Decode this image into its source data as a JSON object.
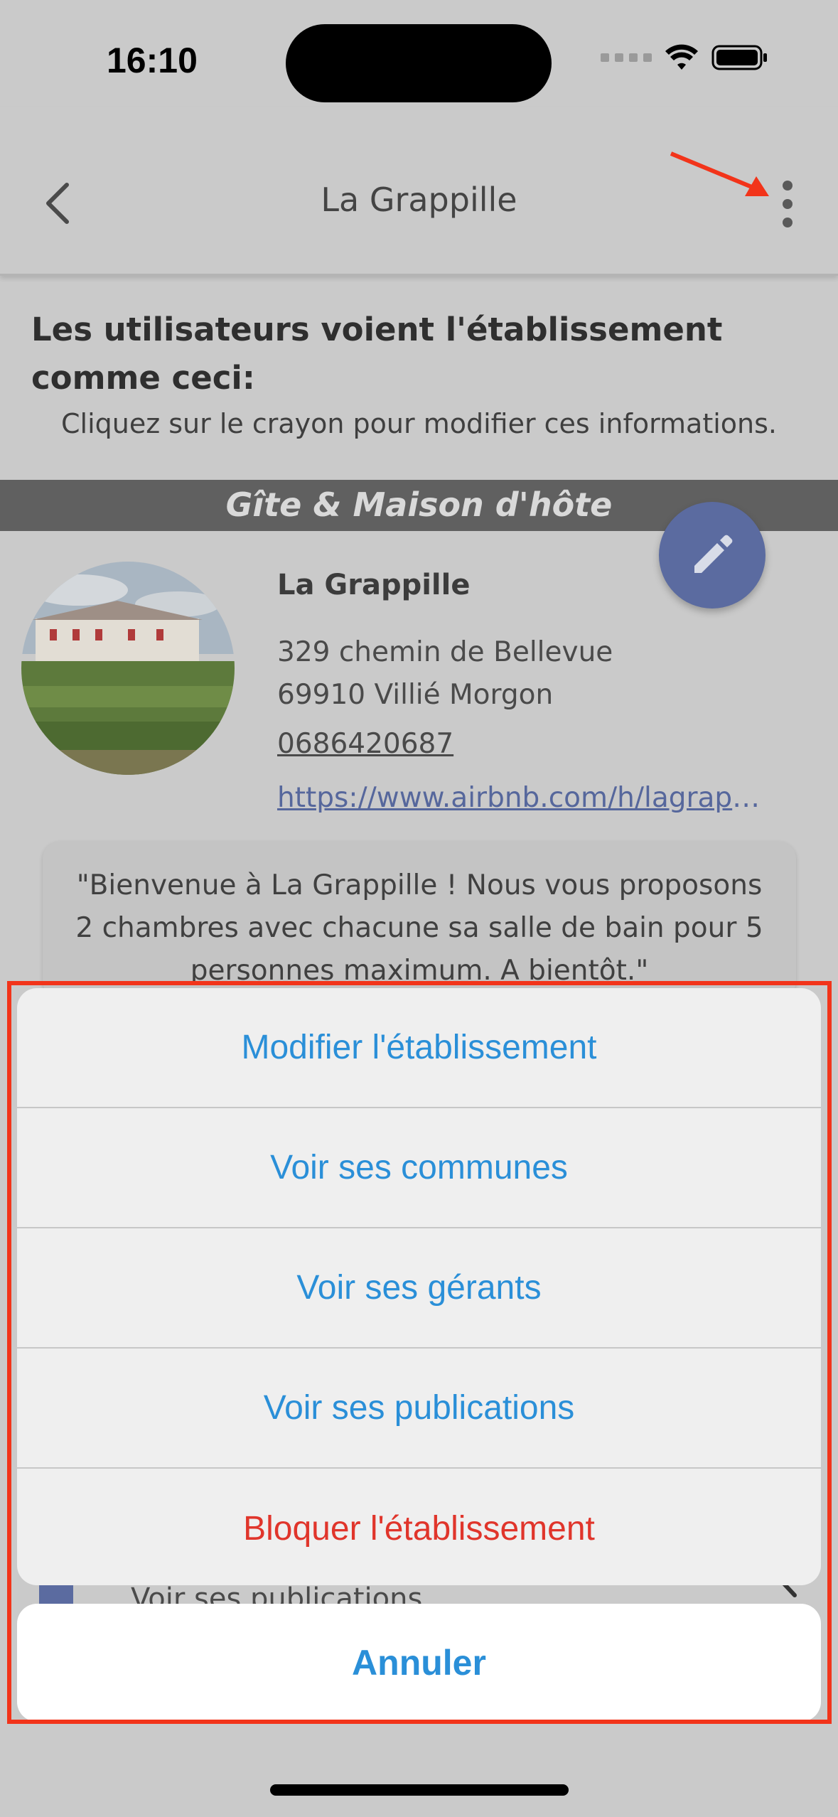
{
  "status_bar": {
    "time": "16:10",
    "icons": [
      "cellular-dots-icon",
      "wifi-icon",
      "battery-icon"
    ]
  },
  "nav": {
    "title": "La Grappille",
    "back_icon": "chevron-left-icon",
    "more_icon": "more-vertical-icon"
  },
  "intro": {
    "heading": "Les utilisateurs voient l'établissement comme ceci:",
    "subheading": "Cliquez sur le crayon pour modifier ces informations."
  },
  "category": "Gîte & Maison d'hôte",
  "establishment": {
    "name": "La Grappille",
    "address_line1": "329 chemin de Bellevue",
    "address_line2": "69910 Villié Morgon",
    "phone": "0686420687",
    "url": "https://www.airbnb.com/h/lagrappille",
    "description": "\"Bienvenue à La Grappille ! Nous vous proposons 2 chambres avec chacune sa salle de bain pour 5 personnes maximum. A bientôt.\""
  },
  "behind_row": {
    "label": "Voir ses publications"
  },
  "action_sheet": {
    "items": [
      {
        "label": "Modifier l'établissement"
      },
      {
        "label": "Voir ses communes"
      },
      {
        "label": "Voir ses gérants"
      },
      {
        "label": "Voir ses publications"
      },
      {
        "label": "Bloquer l'établissement"
      }
    ],
    "cancel": "Annuler"
  },
  "colors": {
    "accent": "#2a8fd8",
    "destructive": "#e0352b",
    "annotation": "#f2341a",
    "fab": "#5b6ba0"
  }
}
